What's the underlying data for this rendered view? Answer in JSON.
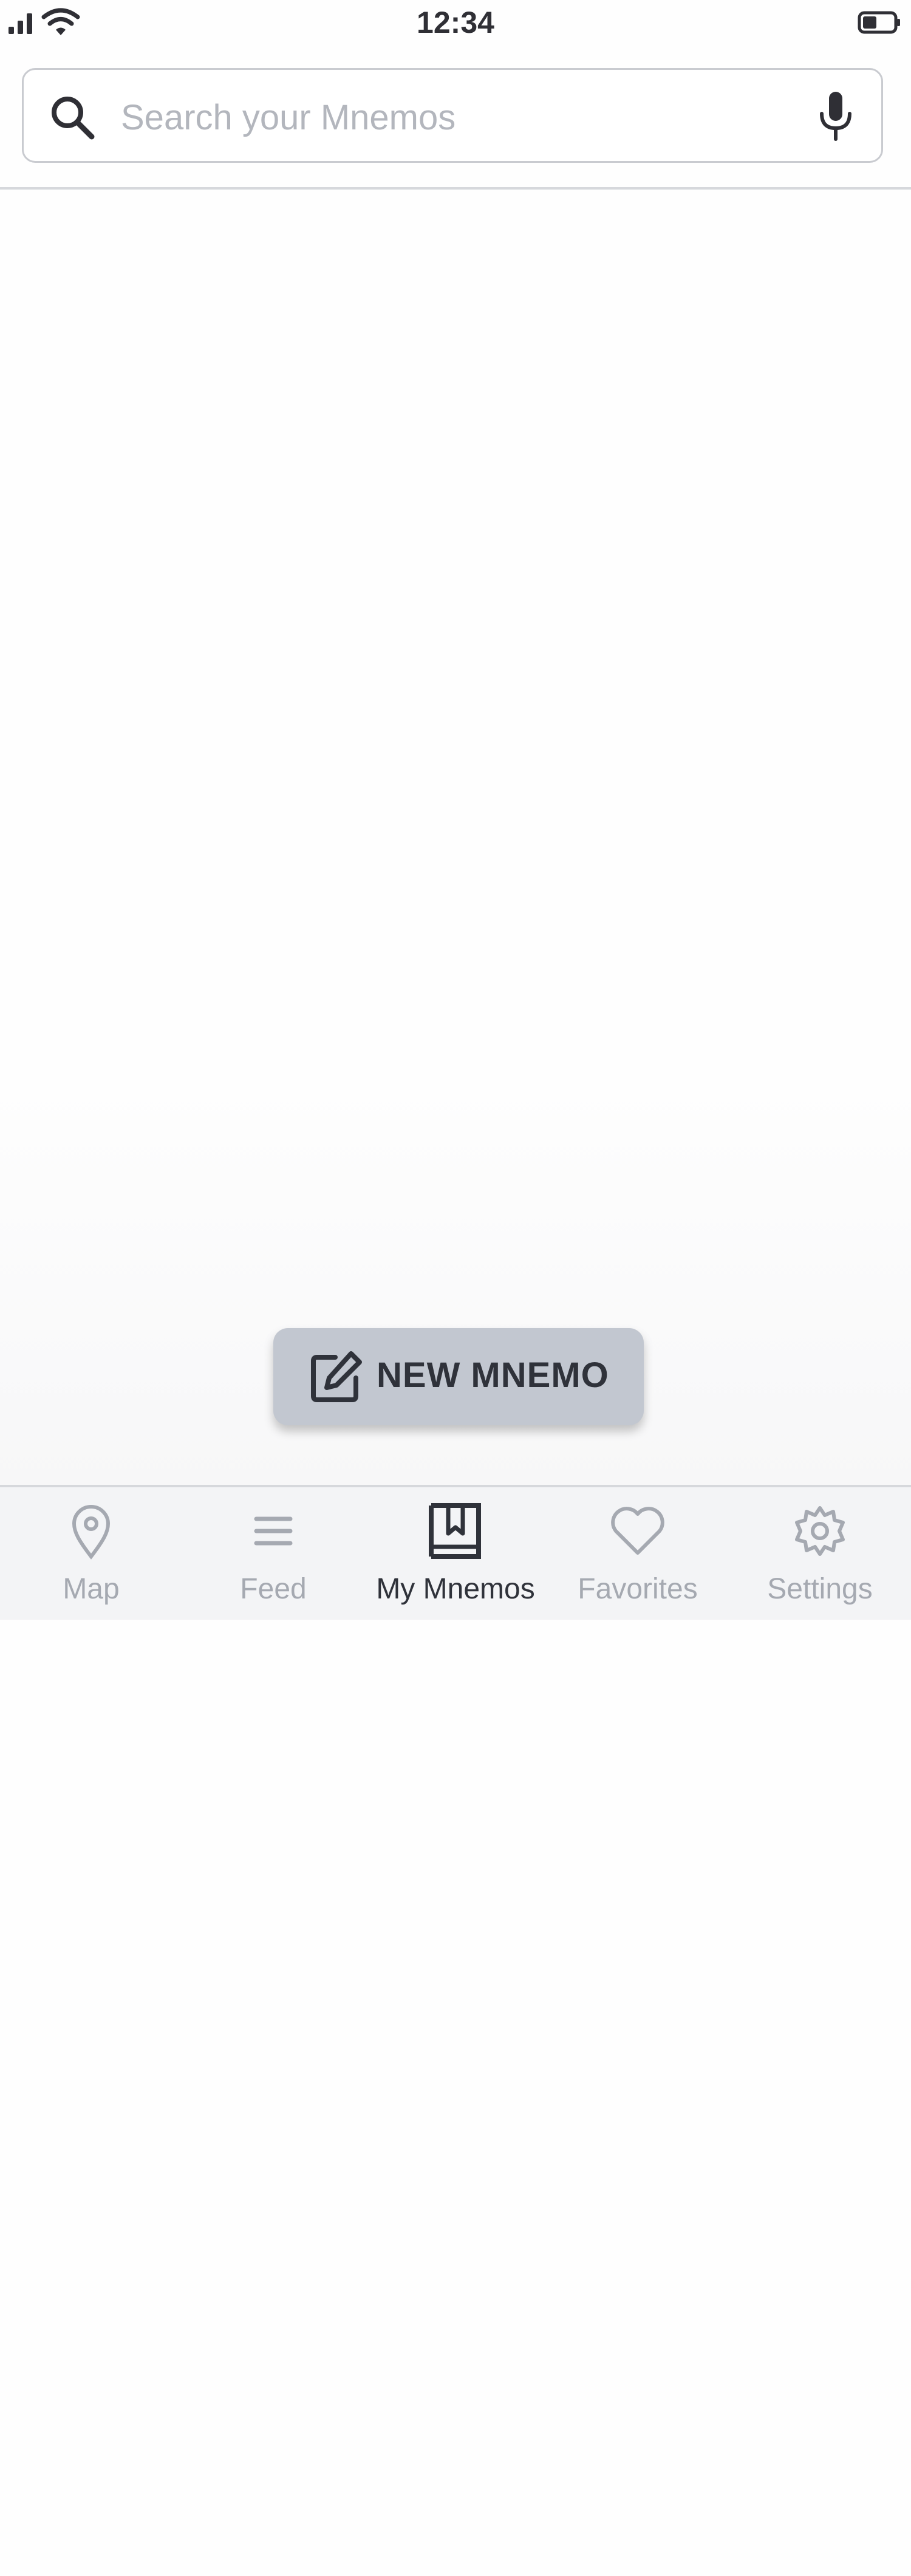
{
  "status_bar": {
    "time": "12:34",
    "icons": [
      "signal-icon",
      "wifi-icon",
      "battery-icon"
    ]
  },
  "search": {
    "placeholder": "Search your Mnemos",
    "value": "",
    "icons": [
      "search-icon",
      "mic-icon"
    ]
  },
  "actions": {
    "new_mnemo_label": "NEW MNEMO",
    "new_mnemo_icon": "edit-icon"
  },
  "tabs": [
    {
      "label": "Map",
      "icon": "map-pin-icon",
      "active": false
    },
    {
      "label": "Feed",
      "icon": "menu-lines-icon",
      "active": false
    },
    {
      "label": "My Mnemos",
      "icon": "bookmark-book-icon",
      "active": true
    },
    {
      "label": "Favorites",
      "icon": "heart-icon",
      "active": false
    },
    {
      "label": "Settings",
      "icon": "gear-icon",
      "active": false
    }
  ],
  "colors": {
    "text_dark": "#2f323a",
    "tab_inactive": "#a5a9b1",
    "button_bg": "#c2c7d0",
    "placeholder": "#b3b6bd"
  }
}
